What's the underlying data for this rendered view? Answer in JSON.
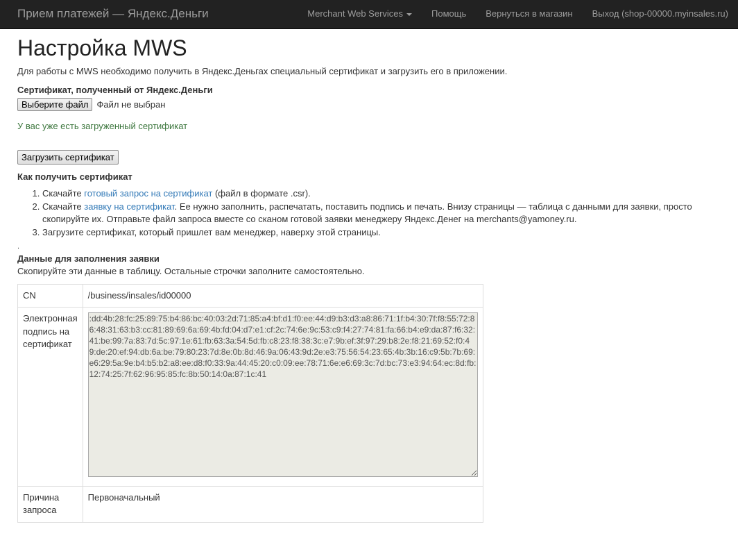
{
  "navbar": {
    "brand": "Прием платежей — Яндекс.Деньги",
    "items": [
      {
        "label": "Merchant Web Services"
      },
      {
        "label": "Помощь"
      },
      {
        "label": "Вернуться в магазин"
      },
      {
        "label": "Выход (shop-00000.myinsales.ru)"
      }
    ]
  },
  "page": {
    "title": "Настройка MWS",
    "intro": "Для работы с MWS необходимо получить в Яндекс.Деньгах специальный сертификат и загрузить его в приложении."
  },
  "upload": {
    "field_label": "Сертификат, полученный от Яндекс.Деньги",
    "choose_button": "Выберите файл",
    "file_status": "Файл не выбран",
    "success_message": "У вас уже есть загруженный сертификат",
    "upload_button": "Загрузить сертификат"
  },
  "howto": {
    "title": "Как получить сертификат",
    "step1": {
      "before": "Скачайте ",
      "link": "готовый запрос на сертификат",
      "after": " (файл в формате .csr)."
    },
    "step2": {
      "before": "Скачайте ",
      "link": "заявку на сертификат",
      "after": ". Ее нужно заполнить, распечатать, поставить подпись и печать. Внизу страницы — таблица с данными для заявки, просто скопируйте их. Отправьте файл запроса вместе со сканом готовой заявки менеджеру Яндекс.Денег на merchants@yamoney.ru."
    },
    "step3": {
      "text": "Загрузите сертификат, который пришлет вам менеджер, наверху этой страницы."
    },
    "stray_dot": "."
  },
  "data_section": {
    "title": "Данные для заполнения заявки",
    "subtitle": "Скопируйте эти данные в таблицу. Остальные строчки заполните самостоятельно.",
    "rows": {
      "cn": {
        "key": "CN",
        "value": "/business/insales/id00000"
      },
      "signature": {
        "key": "Электронная подпись на сертификат",
        "value": ":dd:4b:28:fc:25:89:75:b4:86:bc:40:03:2d:71:85:a4:bf:d1:f0:ee:44:d9:b3:d3:a8:86:71:1f:b4:30:7f:f8:55:72:86:48:31:63:b3:cc:81:89:69:6a:69:4b:fd:04:d7:e1:cf:2c:74:6e:9c:53:c9:f4:27:74:81:fa:66:b4:e9:da:87:f6:32:41:be:99:7a:83:7d:5c:97:1e:61:fb:63:3a:54:5d:fb:c8:23:f8:38:3c:e7:9b:ef:3f:97:29:b8:2e:f8:21:69:52:f0:49:de:20:ef:94:db:6a:be:79:80:23:7d:8e:0b:8d:46:9a:06:43:9d:2e:e3:75:56:54:23:65:4b:3b:16:c9:5b:7b:69:e6:29:5a:9e:b4:b5:b2:a8:ee:d8:f0:33:9a:44:45:20:c0:09:ee:78:71:6e:e6:69:3c:7d:bc:73:e3:94:64:ec:8d:fb:12:74:25:7f:62:96:95:85:fc:8b:50:14:0a:87:1c:41"
      },
      "reason": {
        "key": "Причина запроса",
        "value": "Первоначальный"
      }
    }
  }
}
